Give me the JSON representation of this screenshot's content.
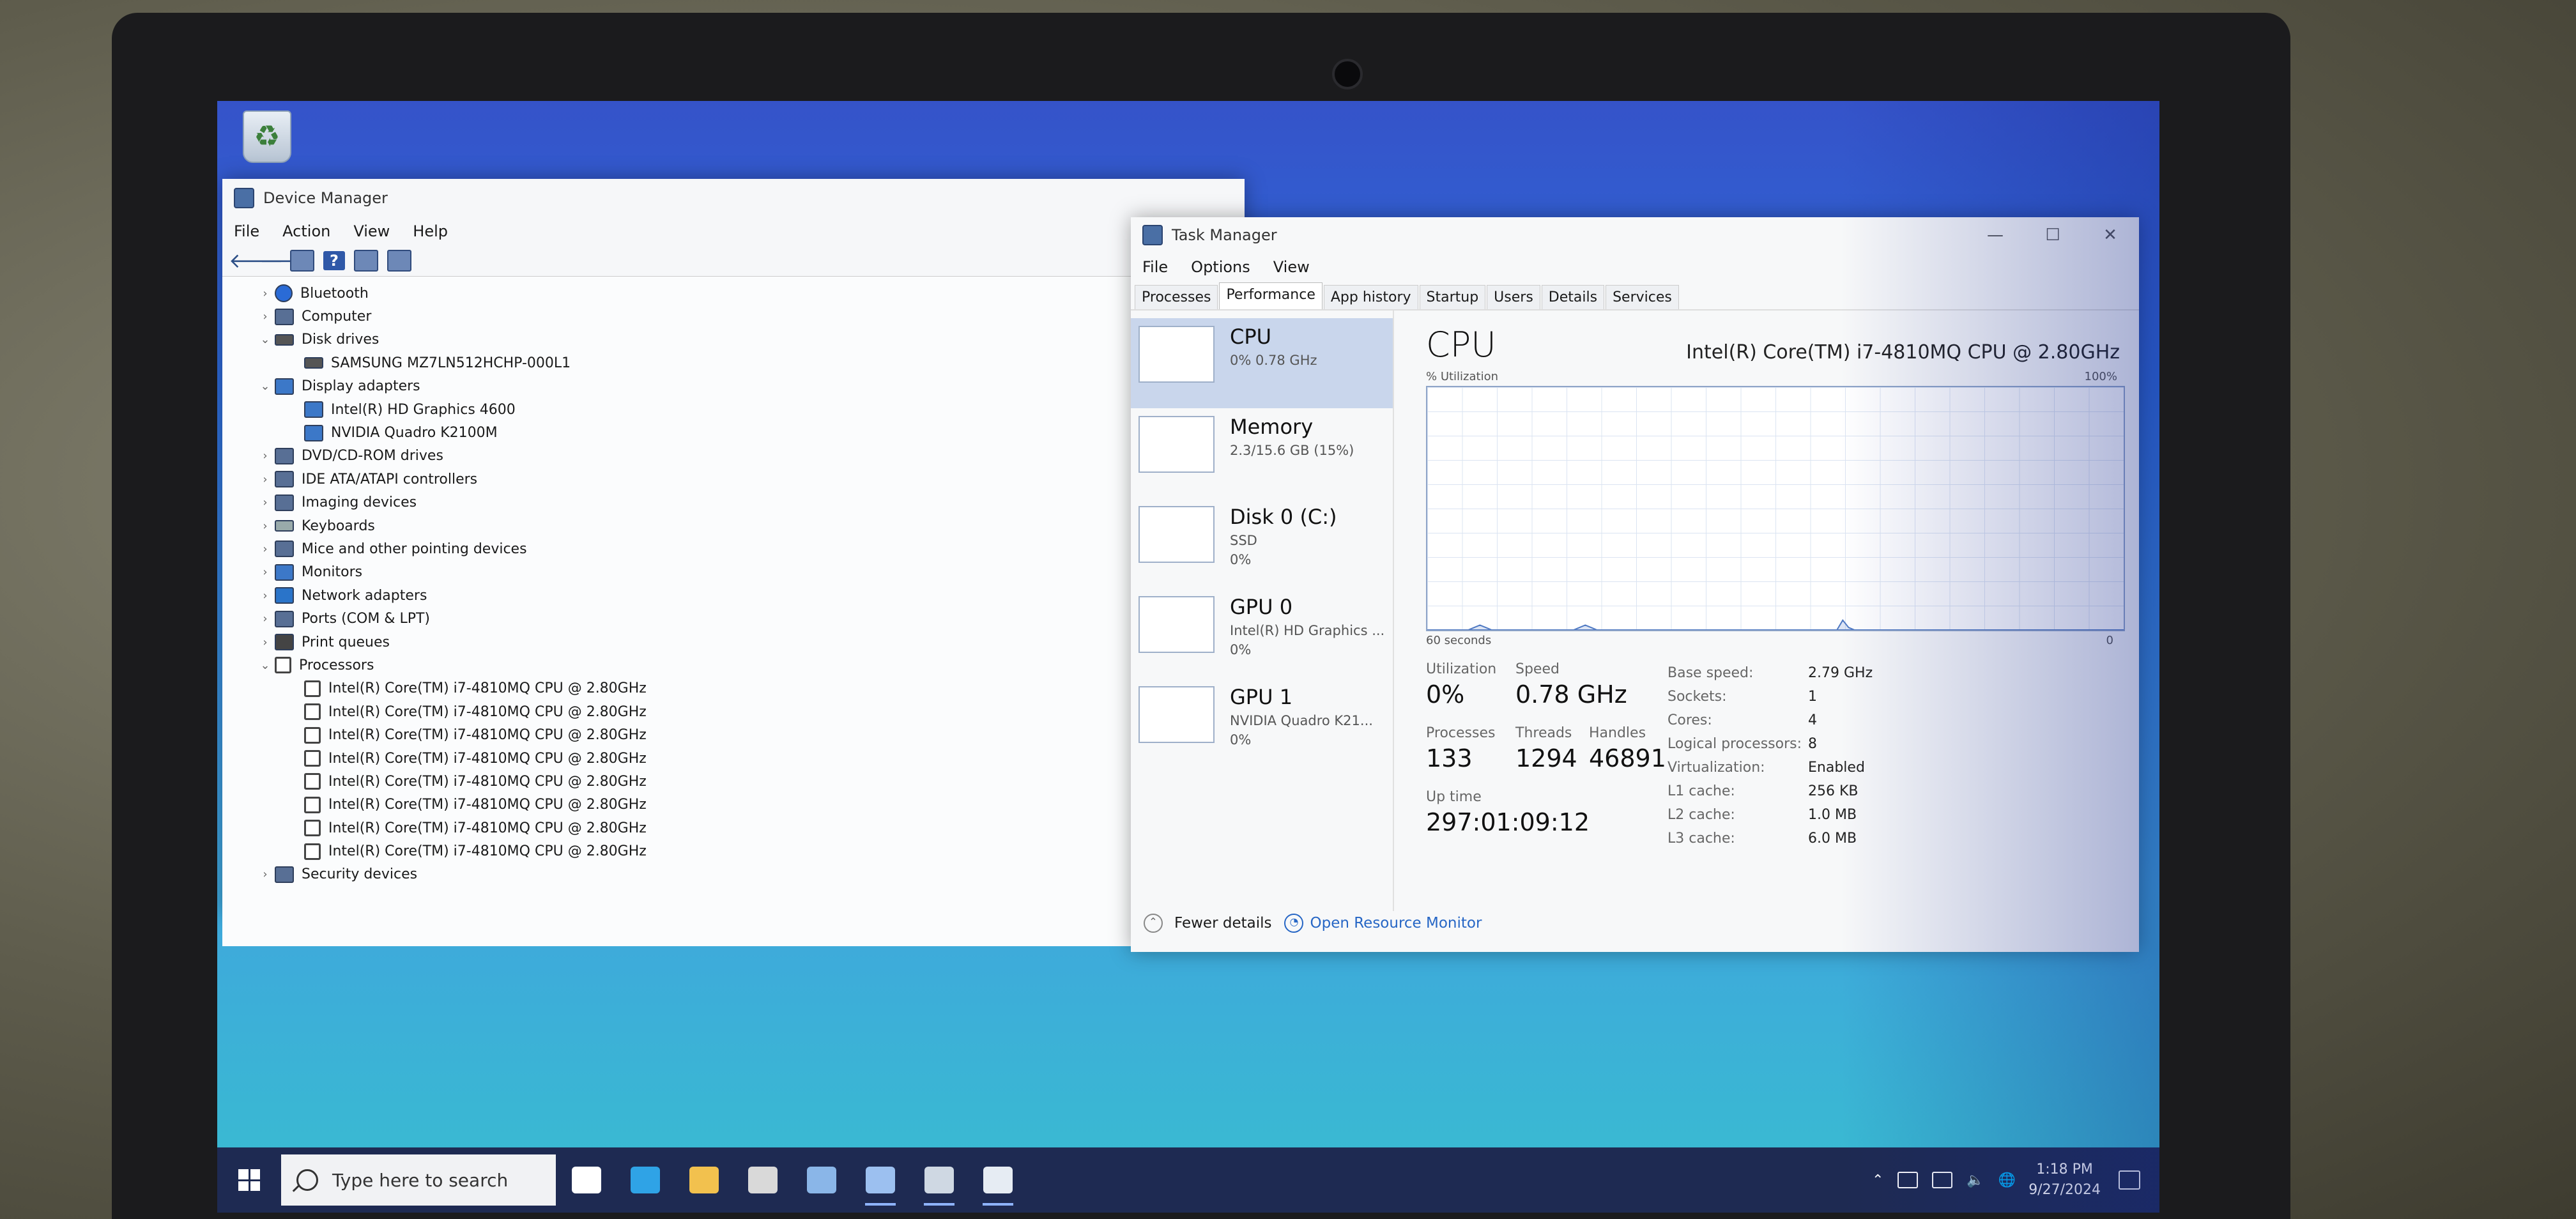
{
  "device_manager": {
    "title": "Device Manager",
    "menu": [
      "File",
      "Action",
      "View",
      "Help"
    ],
    "tree": [
      {
        "label": "Bluetooth",
        "level": 1,
        "expander": "›",
        "icon": "bluetooth-icon"
      },
      {
        "label": "Computer",
        "level": 1,
        "expander": "›",
        "icon": "computer-icon"
      },
      {
        "label": "Disk drives",
        "level": 1,
        "expander": "⌄",
        "icon": "disk-drive-icon"
      },
      {
        "label": "SAMSUNG MZ7LN512HCHP-000L1",
        "level": 2,
        "expander": "",
        "icon": "disk-drive-icon"
      },
      {
        "label": "Display adapters",
        "level": 1,
        "expander": "⌄",
        "icon": "display-adapter-icon"
      },
      {
        "label": "Intel(R) HD Graphics 4600",
        "level": 2,
        "expander": "",
        "icon": "display-adapter-icon"
      },
      {
        "label": "NVIDIA Quadro K2100M",
        "level": 2,
        "expander": "",
        "icon": "display-adapter-icon"
      },
      {
        "label": "DVD/CD-ROM drives",
        "level": 1,
        "expander": "›",
        "icon": "dvd-drive-icon"
      },
      {
        "label": "IDE ATA/ATAPI controllers",
        "level": 1,
        "expander": "›",
        "icon": "ide-controller-icon"
      },
      {
        "label": "Imaging devices",
        "level": 1,
        "expander": "›",
        "icon": "camera-icon"
      },
      {
        "label": "Keyboards",
        "level": 1,
        "expander": "›",
        "icon": "keyboard-icon"
      },
      {
        "label": "Mice and other pointing devices",
        "level": 1,
        "expander": "›",
        "icon": "mouse-icon"
      },
      {
        "label": "Monitors",
        "level": 1,
        "expander": "›",
        "icon": "monitor-icon"
      },
      {
        "label": "Network adapters",
        "level": 1,
        "expander": "›",
        "icon": "network-adapter-icon"
      },
      {
        "label": "Ports (COM & LPT)",
        "level": 1,
        "expander": "›",
        "icon": "port-icon"
      },
      {
        "label": "Print queues",
        "level": 1,
        "expander": "›",
        "icon": "printer-icon"
      },
      {
        "label": "Processors",
        "level": 1,
        "expander": "⌄",
        "icon": "processor-icon"
      },
      {
        "label": "Intel(R) Core(TM) i7-4810MQ CPU @ 2.80GHz",
        "level": 2,
        "expander": "",
        "icon": "processor-icon"
      },
      {
        "label": "Intel(R) Core(TM) i7-4810MQ CPU @ 2.80GHz",
        "level": 2,
        "expander": "",
        "icon": "processor-icon"
      },
      {
        "label": "Intel(R) Core(TM) i7-4810MQ CPU @ 2.80GHz",
        "level": 2,
        "expander": "",
        "icon": "processor-icon"
      },
      {
        "label": "Intel(R) Core(TM) i7-4810MQ CPU @ 2.80GHz",
        "level": 2,
        "expander": "",
        "icon": "processor-icon"
      },
      {
        "label": "Intel(R) Core(TM) i7-4810MQ CPU @ 2.80GHz",
        "level": 2,
        "expander": "",
        "icon": "processor-icon"
      },
      {
        "label": "Intel(R) Core(TM) i7-4810MQ CPU @ 2.80GHz",
        "level": 2,
        "expander": "",
        "icon": "processor-icon"
      },
      {
        "label": "Intel(R) Core(TM) i7-4810MQ CPU @ 2.80GHz",
        "level": 2,
        "expander": "",
        "icon": "processor-icon"
      },
      {
        "label": "Intel(R) Core(TM) i7-4810MQ CPU @ 2.80GHz",
        "level": 2,
        "expander": "",
        "icon": "processor-icon"
      },
      {
        "label": "Security devices",
        "level": 1,
        "expander": "›",
        "icon": "security-device-icon"
      }
    ]
  },
  "task_manager": {
    "title": "Task Manager",
    "menu": [
      "File",
      "Options",
      "View"
    ],
    "tabs": [
      "Processes",
      "Performance",
      "App history",
      "Startup",
      "Users",
      "Details",
      "Services"
    ],
    "active_tab": "Performance",
    "sidebar": [
      {
        "title": "CPU",
        "sub1": "0% 0.78 GHz",
        "sub2": "",
        "selected": true
      },
      {
        "title": "Memory",
        "sub1": "2.3/15.6 GB (15%)",
        "sub2": "",
        "selected": false
      },
      {
        "title": "Disk 0 (C:)",
        "sub1": "SSD",
        "sub2": "0%",
        "selected": false
      },
      {
        "title": "GPU 0",
        "sub1": "Intel(R) HD Graphics ...",
        "sub2": "0%",
        "selected": false
      },
      {
        "title": "GPU 1",
        "sub1": "NVIDIA Quadro K21...",
        "sub2": "0%",
        "selected": false
      }
    ],
    "cpu": {
      "heading": "CPU",
      "model": "Intel(R) Core(TM) i7-4810MQ CPU @ 2.80GHz",
      "util_label": "% Utilization",
      "max_label": "100%",
      "time_label": "60 seconds",
      "min_label": "0",
      "graph_series": [
        0,
        0,
        0,
        0,
        0,
        0,
        0,
        0,
        1,
        2,
        1,
        0,
        0,
        0,
        0,
        0,
        0,
        0,
        0,
        0,
        0,
        0,
        0,
        0,
        0,
        0,
        1,
        2,
        1,
        0,
        0,
        0,
        0,
        0,
        0,
        0,
        0,
        0,
        0,
        0,
        0,
        0,
        0,
        0,
        0,
        0,
        0,
        0,
        0,
        0,
        0,
        0,
        0,
        0,
        0,
        0,
        0,
        0,
        0,
        0,
        0,
        0,
        0,
        0,
        0,
        0,
        0,
        0,
        0,
        0,
        0,
        4,
        1,
        0,
        0,
        0,
        0,
        0,
        0,
        0,
        0,
        0,
        0,
        0,
        0,
        0,
        0,
        0,
        0,
        0,
        0,
        0,
        0,
        0,
        0,
        0,
        0,
        0,
        0,
        0,
        0,
        0,
        0,
        0,
        0,
        0,
        0,
        0,
        0,
        0,
        0,
        0,
        0,
        0,
        0,
        0,
        0,
        0,
        0,
        0
      ],
      "utilization_label": "Utilization",
      "utilization": "0%",
      "speed_label": "Speed",
      "speed": "0.78 GHz",
      "processes_label": "Processes",
      "processes": "133",
      "threads_label": "Threads",
      "threads": "1294",
      "handles_label": "Handles",
      "handles": "46891",
      "uptime_label": "Up time",
      "uptime": "297:01:09:12",
      "details": [
        {
          "k": "Base speed:",
          "v": "2.79 GHz"
        },
        {
          "k": "Sockets:",
          "v": "1"
        },
        {
          "k": "Cores:",
          "v": "4"
        },
        {
          "k": "Logical processors:",
          "v": "8"
        },
        {
          "k": "Virtualization:",
          "v": "Enabled"
        },
        {
          "k": "L1 cache:",
          "v": "256 KB"
        },
        {
          "k": "L2 cache:",
          "v": "1.0 MB"
        },
        {
          "k": "L3 cache:",
          "v": "6.0 MB"
        }
      ]
    },
    "footer": {
      "fewer_details": "Fewer details",
      "resource_monitor": "Open Resource Monitor"
    }
  },
  "taskbar": {
    "search_placeholder": "Type here to search",
    "time": "1:18 PM",
    "date": "9/27/2024",
    "icons": [
      {
        "name": "task-view-icon",
        "color": "#ffffff"
      },
      {
        "name": "edge-icon",
        "color": "#2fa3e6"
      },
      {
        "name": "file-explorer-icon",
        "color": "#f2c14e"
      },
      {
        "name": "microsoft-store-icon",
        "color": "#d9d9d9"
      },
      {
        "name": "mail-icon",
        "color": "#8ab6e8"
      },
      {
        "name": "device-manager-icon",
        "color": "#9cc0f0"
      },
      {
        "name": "remote-desktop-icon",
        "color": "#cfd8e3"
      },
      {
        "name": "task-manager-icon",
        "color": "#e6ecf3"
      }
    ]
  }
}
